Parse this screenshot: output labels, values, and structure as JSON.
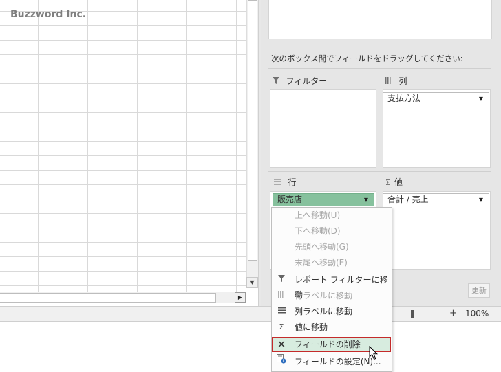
{
  "watermark": "Buzzword Inc.",
  "pane": {
    "instruction": "次のボックス間でフィールドをドラッグしてください:",
    "areas": {
      "filters": {
        "label": "フィルター",
        "icon": "filter-icon"
      },
      "columns": {
        "label": "列",
        "icon": "columns-icon",
        "field": "支払方法"
      },
      "rows": {
        "label": "行",
        "icon": "rows-icon",
        "field": "販売店"
      },
      "values": {
        "label": "値",
        "icon": "sigma-icon",
        "field": "合計 / 売上"
      }
    },
    "update_button": "更新"
  },
  "context_menu": {
    "items": [
      {
        "label": "上へ移動(U)",
        "enabled": false
      },
      {
        "label": "下へ移動(D)",
        "enabled": false
      },
      {
        "label": "先頭へ移動(G)",
        "enabled": false
      },
      {
        "label": "末尾へ移動(E)",
        "enabled": false
      },
      {
        "label": "レポート フィルターに移動",
        "enabled": true,
        "icon": "filter-icon"
      },
      {
        "label": "行ラベルに移動",
        "enabled": false,
        "icon": "columns-icon"
      },
      {
        "label": "列ラベルに移動",
        "enabled": true,
        "icon": "rows-icon"
      },
      {
        "label": "値に移動",
        "enabled": true,
        "icon": "sigma-icon"
      },
      {
        "label": "フィールドの削除",
        "enabled": true,
        "icon": "remove-field-icon",
        "highlighted": true
      },
      {
        "label": "フィールドの設定(N)...",
        "enabled": true,
        "icon": "field-settings-icon"
      }
    ]
  },
  "statusbar": {
    "zoom_minus": "−",
    "zoom_plus": "+",
    "zoom_percent": "100%"
  },
  "colors": {
    "selected_field": "#86c19d",
    "highlight_border": "#c42b2b",
    "highlight_fill": "#d7ecdf"
  }
}
